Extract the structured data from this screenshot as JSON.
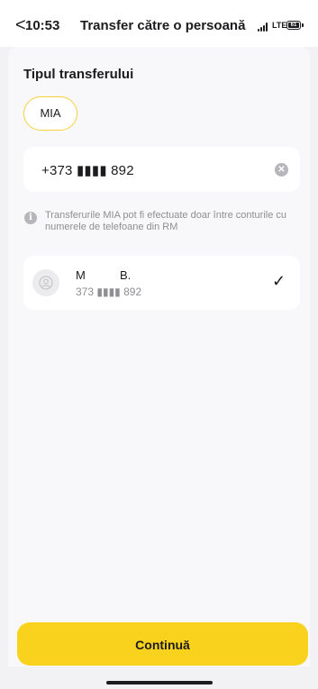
{
  "status_bar": {
    "back_glyph": "<",
    "time": "10:53",
    "title": "Transfer către o persoană",
    "network": "LTE",
    "battery": "61"
  },
  "form": {
    "section_label": "Tipul transferului",
    "transfer_type": "MIA",
    "phone_value": "+373 ▮▮▮▮ 892",
    "info_text": "Transferurile MIA pot fi efectuate doar între conturile cu numerele de telefoane din RM"
  },
  "contact": {
    "first_initial": "M",
    "last_initial": "B.",
    "phone": "373 ▮▮▮▮ 892",
    "selected": true
  },
  "footer": {
    "continue_label": "Continuă"
  },
  "colors": {
    "accent": "#f8d21c",
    "chip_border": "#f4d23c",
    "muted_text": "#8e8e93",
    "background": "#f2f2f4"
  },
  "icons": [
    "back-chevron-icon",
    "signal-icon",
    "battery-icon",
    "clear-icon",
    "info-icon",
    "user-avatar-icon",
    "checkmark-icon"
  ]
}
